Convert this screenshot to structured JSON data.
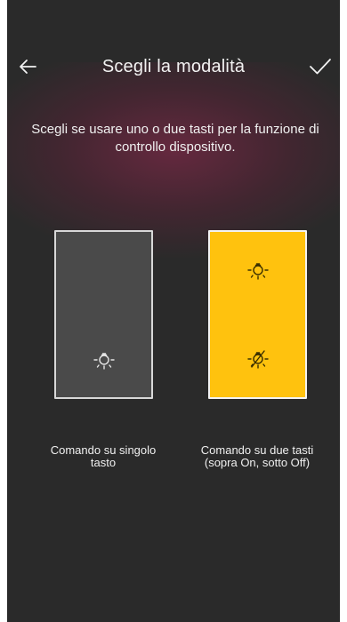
{
  "header": {
    "title": "Scegli la modalità",
    "back_icon": "arrow-left-icon",
    "confirm_icon": "checkmark-icon"
  },
  "description": "Scegli se usare uno o due tasti per la funzione di controllo dispositivo.",
  "options": [
    {
      "label": "Comando su singolo tasto",
      "selected": false,
      "icons": [
        "light-bulb-icon"
      ],
      "tile_color": "#4a4a4a"
    },
    {
      "label": "Comando su due tasti (sopra On, sotto Off)",
      "selected": true,
      "icons": [
        "light-bulb-on-icon",
        "light-bulb-off-icon"
      ],
      "tile_color": "#ffc20e"
    }
  ],
  "colors": {
    "background": "#2a2a2a",
    "accent": "#ffc20e",
    "glow": "#962850"
  }
}
